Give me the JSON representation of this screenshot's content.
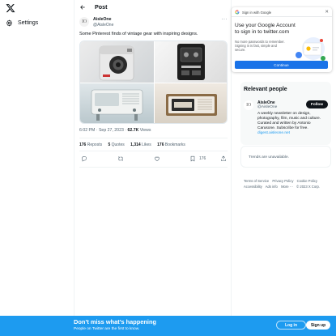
{
  "nav": {
    "logo_icon": "x-logo-icon",
    "settings_label": "Settings",
    "settings_icon": "gear-icon"
  },
  "header": {
    "title": "Post",
    "back_icon": "arrow-left-icon"
  },
  "post": {
    "author_name": "AisleOne",
    "author_handle": "@AisleOne",
    "avatar_text": "IO",
    "more_icon": "more-horizontal-icon",
    "text": "Some Pinterest finds of vintage gear with inspiring designs.",
    "time": "6:02 PM",
    "date": "Sep 27, 2023",
    "views_count": "62.7K",
    "views_label": "Views",
    "separator": "·",
    "stats": {
      "reposts_count": "176",
      "reposts_label": "Reposts",
      "quotes_count": "5",
      "quotes_label": "Quotes",
      "likes_count": "1,314",
      "likes_label": "Likes",
      "bookmarks_count": "176",
      "bookmarks_label": "Bookmarks"
    },
    "actions": {
      "reply_icon": "reply-icon",
      "repost_icon": "repost-icon",
      "like_icon": "heart-icon",
      "bookmark_icon": "bookmark-icon",
      "bookmark_count": "176",
      "share_icon": "share-icon"
    },
    "media_tiles": [
      "vintage-camera",
      "portable-cassette-player",
      "vintage-radio",
      "vintage-clock-radio"
    ]
  },
  "google_prompt": {
    "header_label": "Sign in with Google",
    "close_icon": "close-icon",
    "title": "Use your Google Account to sign in to twitter.com",
    "description": "No more passwords to remember. Signing in is fast, simple and secure.",
    "button_label": "Continue",
    "accent_color": "#1a73e8"
  },
  "relevant_people": {
    "heading": "Relevant people",
    "avatar_text": "IO",
    "name": "AisleOne",
    "handle": "@AisleOne",
    "follow_label": "Follow",
    "bio": "A weekly newsletter on design, photography, film, music and culture. Curated and written by Antonio Carusone. Subscribe for free.",
    "bio_link": "digest.aisleone.net"
  },
  "trends": {
    "message": "Trends are unavailable."
  },
  "footer": {
    "links": [
      "Terms of Service",
      "Privacy Policy",
      "Cookie Policy",
      "Accessibility",
      "Ads info",
      "More ···",
      "© 2023 X Corp."
    ]
  },
  "banner": {
    "headline": "Don’t miss what’s happening",
    "subtext": "People on Twitter are the first to know.",
    "login_label": "Log in",
    "signup_label": "Sign up",
    "background": "#1d9bf0"
  }
}
